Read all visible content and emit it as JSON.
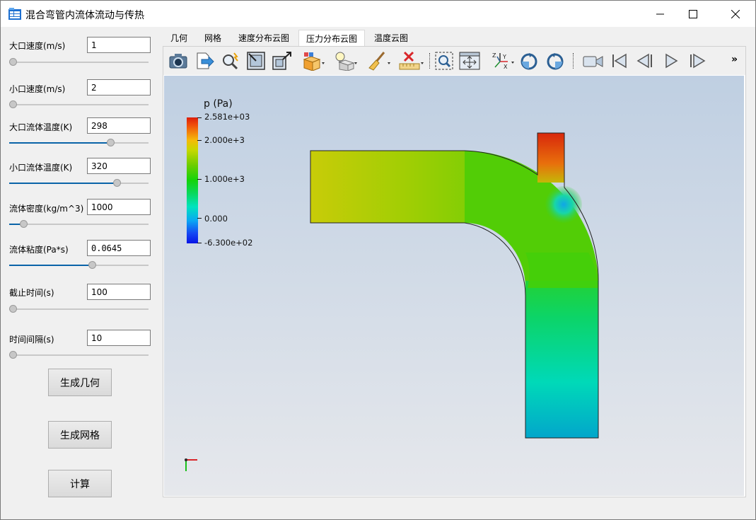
{
  "window": {
    "title": "混合弯管内流体流动与传热",
    "icons": [
      "app-icon",
      "minimize-icon",
      "maximize-icon",
      "close-icon"
    ]
  },
  "params": [
    {
      "label": "大口速度(m/s)",
      "value": "1",
      "level": 0.0
    },
    {
      "label": "小口速度(m/s)",
      "value": "2",
      "level": 0.0
    },
    {
      "label": "大口流体温度(K)",
      "value": "298",
      "level": 0.74
    },
    {
      "label": "小口流体温度(K)",
      "value": "320",
      "level": 0.79
    },
    {
      "label": "流体密度(kg/m^3)",
      "value": "1000",
      "level": 0.08
    },
    {
      "label": "流体粘度(Pa*s)",
      "value": "0.0645",
      "level": 0.6
    },
    {
      "label": "截止时间(s)",
      "value": "100",
      "level": 0.0
    },
    {
      "label": "时间间隔(s)",
      "value": "10",
      "level": 0.0
    }
  ],
  "buttons": {
    "geometry": "生成几何",
    "mesh": "生成网格",
    "compute": "计算"
  },
  "tabs": [
    {
      "label": "几何",
      "active": false
    },
    {
      "label": "网格",
      "active": false
    },
    {
      "label": "速度分布云图",
      "active": false
    },
    {
      "label": "压力分布云图",
      "active": true
    },
    {
      "label": "温度云图",
      "active": false
    }
  ],
  "toolbar": {
    "icons": [
      "camera-icon",
      "export-icon",
      "magnifier-icon",
      "reset-camera-icon",
      "zoom-to-box-icon",
      "representation-icon",
      "light-icon",
      "color-brush-icon",
      "ruler-icon",
      "zoom-select-icon",
      "fit-view-icon",
      "axes-orient-icon",
      "rotate-cw-icon",
      "rotate-ccw-icon",
      "video-camera-icon",
      "first-frame-icon",
      "prev-frame-icon",
      "play-icon",
      "last-frame-icon"
    ],
    "more": "»"
  },
  "legend": {
    "title": "p (Pa)",
    "ticks": [
      "2.581e+03",
      "2.000e+3",
      "1.000e+3",
      "0.000",
      "-6.300e+02"
    ],
    "tick_values": [
      2581,
      2000,
      1000,
      0,
      -630
    ]
  },
  "colors": {
    "accent": "#0a64a8",
    "render_top": "#bfcfe2",
    "render_bottom": "#e6e8ec"
  }
}
